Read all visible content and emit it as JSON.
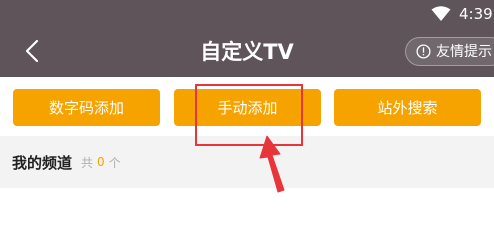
{
  "status_bar": {
    "time": "4:39",
    "wifi_icon": "wifi-icon"
  },
  "header": {
    "back_icon": "chevron-left-icon",
    "title": "自定义TV",
    "tips_label": "友情提示",
    "tips_icon": "info-circle-icon"
  },
  "actions": [
    {
      "label": "数字码添加"
    },
    {
      "label": "手动添加"
    },
    {
      "label": "站外搜索"
    }
  ],
  "channels": {
    "title": "我的频道",
    "count_prefix": "共",
    "count": "0",
    "count_suffix": "个"
  },
  "colors": {
    "header_bg": "#5e5459",
    "accent": "#f6a300",
    "annotation": "#e8353a",
    "section_bg": "#f3f3f3"
  }
}
